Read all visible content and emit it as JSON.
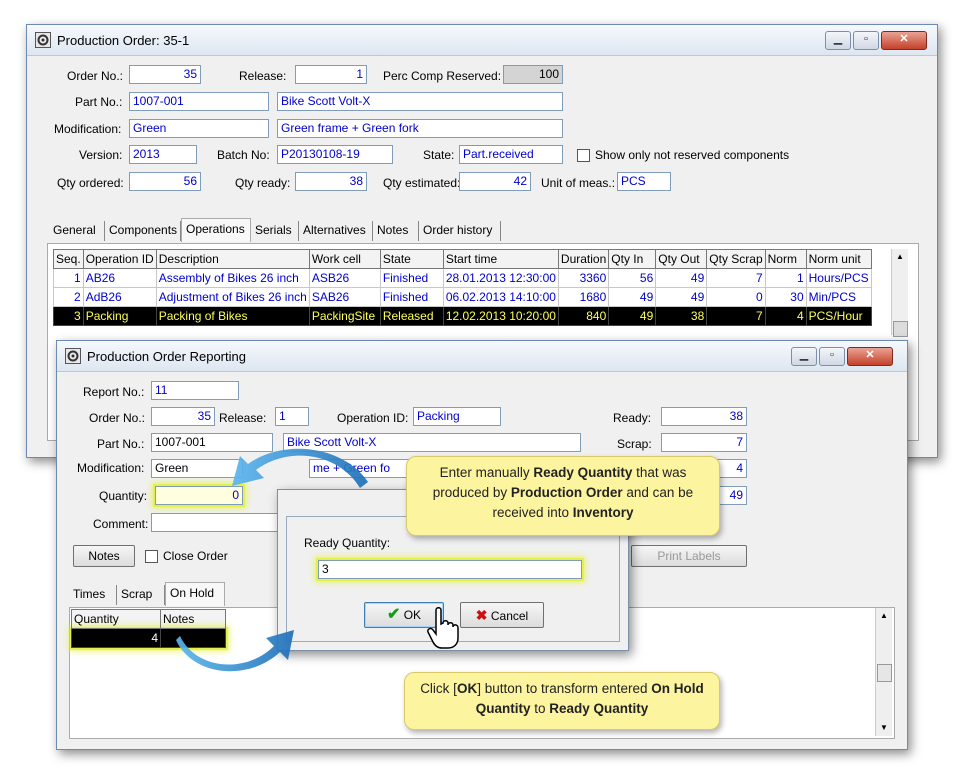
{
  "main_window": {
    "title": "Production Order: 35-1",
    "fields": {
      "order_no_label": "Order No.:",
      "order_no": "35",
      "release_label": "Release:",
      "release": "1",
      "perc_label": "Perc Comp Reserved:",
      "perc": "100",
      "part_no_label": "Part No.:",
      "part_no": "1007-001",
      "part_desc": "Bike Scott Volt-X",
      "modification_label": "Modification:",
      "modification": "Green",
      "modification_desc": "Green frame + Green fork",
      "version_label": "Version:",
      "version": "2013",
      "batch_label": "Batch No:",
      "batch": "P20130108-19",
      "state_label": "State:",
      "state": "Part.received",
      "show_label": "Show only not reserved components",
      "qty_ordered_label": "Qty ordered:",
      "qty_ordered": "56",
      "qty_ready_label": "Qty ready:",
      "qty_ready": "38",
      "qty_estimated_label": "Qty estimated:",
      "qty_estimated": "42",
      "uom_label": "Unit of meas.:",
      "uom": "PCS"
    },
    "tabs": [
      "General",
      "Components",
      "Operations",
      "Serials",
      "Alternatives",
      "Notes",
      "Order history"
    ],
    "grid_headers": [
      "Seq.",
      "Operation ID",
      "Description",
      "Work cell",
      "State",
      "Start time",
      "Duration",
      "Qty In",
      "Qty Out",
      "Qty Scrap",
      "Norm",
      "Norm unit"
    ],
    "grid_rows": [
      [
        "1",
        "AB26",
        "Assembly of Bikes 26 inch",
        "ASB26",
        "Finished",
        "28.01.2013 12:30:00",
        "3360",
        "56",
        "49",
        "7",
        "1",
        "Hours/PCS"
      ],
      [
        "2",
        "AdB26",
        "Adjustment of Bikes 26 inch",
        "SAB26",
        "Finished",
        "06.02.2013 14:10:00",
        "1680",
        "49",
        "49",
        "0",
        "30",
        "Min/PCS"
      ],
      [
        "3",
        "Packing",
        "Packing of Bikes",
        "PackingSite",
        "Released",
        "12.02.2013 10:20:00",
        "840",
        "49",
        "38",
        "7",
        "4",
        "PCS/Hour"
      ]
    ]
  },
  "report_window": {
    "title": "Production Order Reporting",
    "report_no_label": "Report No.:",
    "report_no": "11",
    "order_no_label": "Order No.:",
    "order_no": "35",
    "release_label": "Release:",
    "release": "1",
    "operation_label": "Operation ID:",
    "operation": "Packing",
    "ready_label": "Ready:",
    "ready": "38",
    "scrap_label": "Scrap:",
    "scrap": "7",
    "part_no_label": "Part No.:",
    "part_no": "1007-001",
    "part_desc": "Bike Scott Volt-X",
    "modification_label": "Modification:",
    "modification": "Green",
    "modification_desc_partial": "me + Green fo",
    "extra_val_1": "4",
    "extra_val_2": "49",
    "quantity_label": "Quantity:",
    "quantity": "0",
    "comment_label": "Comment:",
    "notes_button": "Notes",
    "close_order_label": "Close Order",
    "print_labels_button": "Print Labels",
    "tabs": [
      "Times",
      "Scrap",
      "On Hold"
    ],
    "hold_headers": [
      "Quantity",
      "Notes"
    ],
    "hold_row": [
      "4",
      ""
    ]
  },
  "dialog": {
    "label": "Ready Quantity:",
    "value": "3",
    "ok_button": "OK",
    "cancel_button": "Cancel"
  },
  "callouts": {
    "top": {
      "p1": "Enter manually ",
      "b1": "Ready Quantity",
      "p2": " that was produced by ",
      "b2": "Production Order",
      "p3": " and can be received into ",
      "b3": "Inventory"
    },
    "bottom": {
      "p1": "Click [",
      "b1": "OK",
      "p2": "] button to transform entered ",
      "b2": "On Hold Quantity",
      "p3": " to ",
      "b3": "Ready Quantity"
    }
  },
  "colors": {
    "field_text": "#0000cc",
    "selected_row_text": "#ffff55",
    "callout_bg": "#fdf4a0",
    "highlight": "#e6f04a"
  }
}
